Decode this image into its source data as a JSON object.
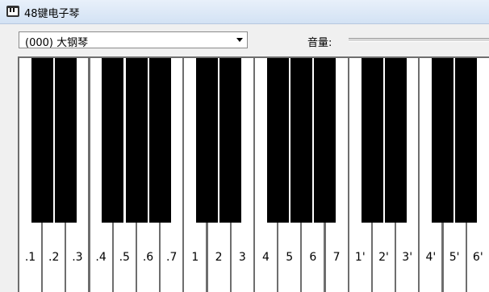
{
  "window": {
    "title": "48键电子琴"
  },
  "instrument_select": {
    "value": "(000) 大钢琴"
  },
  "volume": {
    "label": "音量:"
  },
  "keyboard": {
    "white_keys": [
      ".1",
      ".2",
      ".3",
      ".4",
      ".5",
      ".6",
      ".7",
      "1",
      "2",
      "3",
      "4",
      "5",
      "6",
      "7",
      "1'",
      "2'",
      "3'",
      "4'",
      "5'",
      "6'"
    ]
  }
}
